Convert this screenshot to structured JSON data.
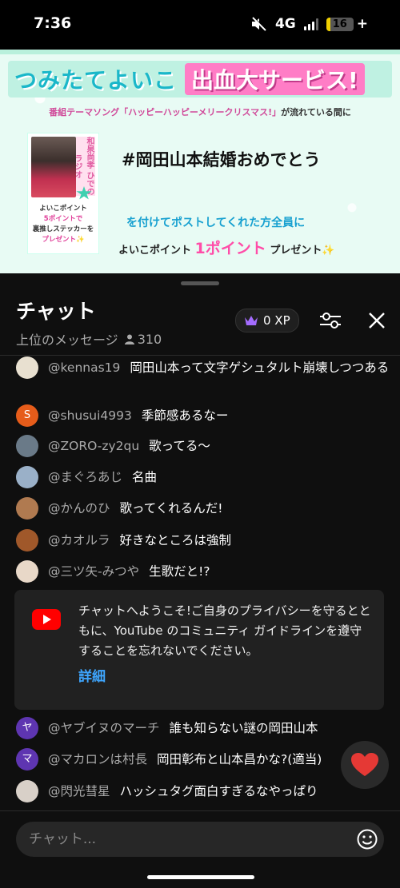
{
  "status_bar": {
    "time": "7:36",
    "network": "4G",
    "battery": "16",
    "battery_level": 0.16
  },
  "banner": {
    "brand": "つみたてよいこ",
    "promo": "出血大サービス!",
    "subtitle_song": "番組テーマソング「ハッピーハッピーメリークリスマス!」",
    "subtitle_rest": "が流れている間に",
    "card_vertical_text": "和泉尚孝 ひでのラジオ",
    "card_line1": "よいこポイント",
    "card_line2": "5ポイントで",
    "card_line3": "裏推しステッカーを",
    "card_line4": "プレゼント✨",
    "hashtag": "#岡田山本結婚おめでとう",
    "cta": "を付けてポストしてくれた方全員に",
    "reward_prefix": "よいこポイント",
    "reward_big": "1ポイント",
    "reward_suffix": "プレゼント✨"
  },
  "chat": {
    "title": "チャット",
    "mode": "上位のメッセージ",
    "viewers": "310",
    "xp": "0 XP",
    "messages": [
      {
        "author": "@kennas19",
        "text": "岡田山本って文字ゲシュタルト崩壊しつつある",
        "avatar_color": "#e8e0d0",
        "avatar_letter": ""
      },
      {
        "author": "@shusui4993",
        "text": "季節感あるなー",
        "avatar_color": "#e65c1a",
        "avatar_letter": "S"
      },
      {
        "author": "@ZORO-zy2qu",
        "text": "歌ってる〜",
        "avatar_color": "#6a7a88",
        "avatar_letter": ""
      },
      {
        "author": "@まぐろあじ",
        "text": "名曲",
        "avatar_color": "#9ab0c8",
        "avatar_letter": ""
      },
      {
        "author": "@かんのひ",
        "text": "歌ってくれるんだ!",
        "avatar_color": "#b07a50",
        "avatar_letter": ""
      },
      {
        "author": "@カオルラ",
        "text": "好きなところは強制",
        "avatar_color": "#a0582a",
        "avatar_letter": ""
      },
      {
        "author": "@三ツ矢-みつや",
        "text": "生歌だと!?",
        "avatar_color": "#e8d8c8",
        "avatar_letter": ""
      },
      {
        "author": "@ヤブイヌのマーチ",
        "text": "誰も知らない謎の岡田山本",
        "avatar_color": "#5e35b1",
        "avatar_letter": "ヤ"
      },
      {
        "author": "@マカロンは村長",
        "text": "岡田彰布と山本昌かな?(適当)",
        "avatar_color": "#5e35b1",
        "avatar_letter": "マ"
      },
      {
        "author": "@閃光彗星",
        "text": "ハッシュタグ面白すぎるなやっぱり",
        "avatar_color": "#d8d0c8",
        "avatar_letter": ""
      }
    ],
    "welcome": {
      "text": "チャットへようこそ!ご自身のプライバシーを守るとともに、YouTube のコミュニティ ガイドラインを遵守することを忘れないでください。",
      "link": "詳細"
    },
    "input_placeholder": "チャット..."
  },
  "colors": {
    "accent_link": "#3ea6ff",
    "youtube_red": "#ff0000",
    "heart": "#e53935"
  },
  "icons": [
    "mute-icon",
    "signal-icon",
    "battery-icon",
    "person-icon",
    "crown-icon",
    "filter-icon",
    "close-icon",
    "youtube-icon",
    "heart-icon",
    "emoji-icon"
  ]
}
